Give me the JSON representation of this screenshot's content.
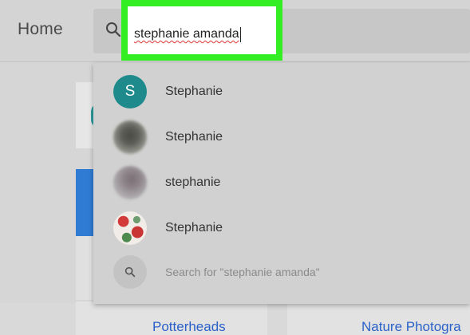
{
  "header": {
    "home_label": "Home"
  },
  "search": {
    "query": "stephanie amanda",
    "icon": "search-icon"
  },
  "dropdown": {
    "suggestions": [
      {
        "name": "Stephanie",
        "avatar_letter": "S",
        "avatar_color": "#1f8a8c"
      },
      {
        "name": "Stephanie"
      },
      {
        "name": "stephanie"
      },
      {
        "name": "Stephanie"
      }
    ],
    "search_for_label": "Search for \"stephanie amanda\""
  },
  "background": {
    "tiles": [
      {
        "label": "Potterheads"
      },
      {
        "label": "Nature Photogra"
      }
    ]
  },
  "colors": {
    "highlight": "#33ee22",
    "accent_teal": "#1f8a8c",
    "link_blue": "#2a62c9"
  }
}
